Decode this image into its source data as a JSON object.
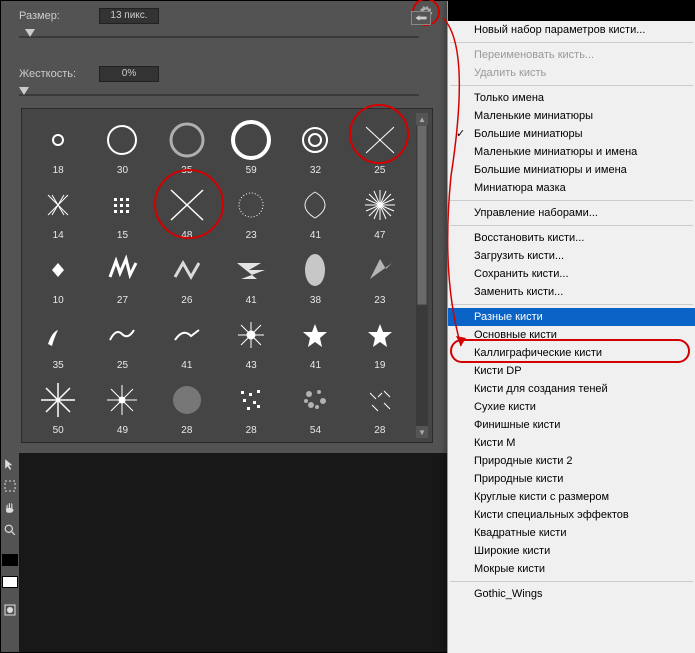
{
  "sliders": {
    "size": {
      "label": "Размер:",
      "value": "13 пикс."
    },
    "hardness": {
      "label": "Жесткость:",
      "value": "0%"
    }
  },
  "brushes": [
    {
      "n": "18"
    },
    {
      "n": "30"
    },
    {
      "n": "35"
    },
    {
      "n": "59"
    },
    {
      "n": "32"
    },
    {
      "n": "25"
    },
    {
      "n": "14"
    },
    {
      "n": "15"
    },
    {
      "n": "48"
    },
    {
      "n": "23"
    },
    {
      "n": "41"
    },
    {
      "n": "47"
    },
    {
      "n": "10"
    },
    {
      "n": "27"
    },
    {
      "n": "26"
    },
    {
      "n": "41"
    },
    {
      "n": "38"
    },
    {
      "n": "23"
    },
    {
      "n": "35"
    },
    {
      "n": "25"
    },
    {
      "n": "41"
    },
    {
      "n": "43"
    },
    {
      "n": "41"
    },
    {
      "n": "19"
    },
    {
      "n": "50"
    },
    {
      "n": "49"
    },
    {
      "n": "28"
    },
    {
      "n": "28"
    },
    {
      "n": "54"
    },
    {
      "n": "28"
    }
  ],
  "menu": {
    "header": "",
    "items": [
      {
        "t": "Новый набор параметров кисти...",
        "k": "item"
      },
      {
        "t": "",
        "k": "sep"
      },
      {
        "t": "Переименовать кисть...",
        "k": "disabled"
      },
      {
        "t": "Удалить кисть",
        "k": "disabled"
      },
      {
        "t": "",
        "k": "sep"
      },
      {
        "t": "Только имена",
        "k": "item"
      },
      {
        "t": "Маленькие миниатюры",
        "k": "item"
      },
      {
        "t": "Большие миниатюры",
        "k": "checked"
      },
      {
        "t": "Маленькие миниатюры и имена",
        "k": "item"
      },
      {
        "t": "Большие миниатюры и имена",
        "k": "item"
      },
      {
        "t": "Миниатюра мазка",
        "k": "item"
      },
      {
        "t": "",
        "k": "sep"
      },
      {
        "t": "Управление наборами...",
        "k": "item"
      },
      {
        "t": "",
        "k": "sep"
      },
      {
        "t": "Восстановить кисти...",
        "k": "item"
      },
      {
        "t": "Загрузить кисти...",
        "k": "item"
      },
      {
        "t": "Сохранить кисти...",
        "k": "item"
      },
      {
        "t": "Заменить кисти...",
        "k": "item"
      },
      {
        "t": "",
        "k": "sep"
      },
      {
        "t": "Разные кисти",
        "k": "highlight"
      },
      {
        "t": "Основные кисти",
        "k": "item"
      },
      {
        "t": "Каллиграфические кисти",
        "k": "item"
      },
      {
        "t": "Кисти DP",
        "k": "item"
      },
      {
        "t": "Кисти для создания теней",
        "k": "item"
      },
      {
        "t": "Сухие кисти",
        "k": "item"
      },
      {
        "t": "Финишные кисти",
        "k": "item"
      },
      {
        "t": "Кисти M",
        "k": "item"
      },
      {
        "t": "Природные кисти 2",
        "k": "item"
      },
      {
        "t": "Природные кисти",
        "k": "item"
      },
      {
        "t": "Круглые кисти с размером",
        "k": "item"
      },
      {
        "t": "Кисти специальных эффектов",
        "k": "item"
      },
      {
        "t": "Квадратные кисти",
        "k": "item"
      },
      {
        "t": "Широкие кисти",
        "k": "item"
      },
      {
        "t": "Мокрые кисти",
        "k": "item"
      },
      {
        "t": "",
        "k": "sep"
      },
      {
        "t": "Gothic_Wings",
        "k": "item"
      }
    ]
  }
}
